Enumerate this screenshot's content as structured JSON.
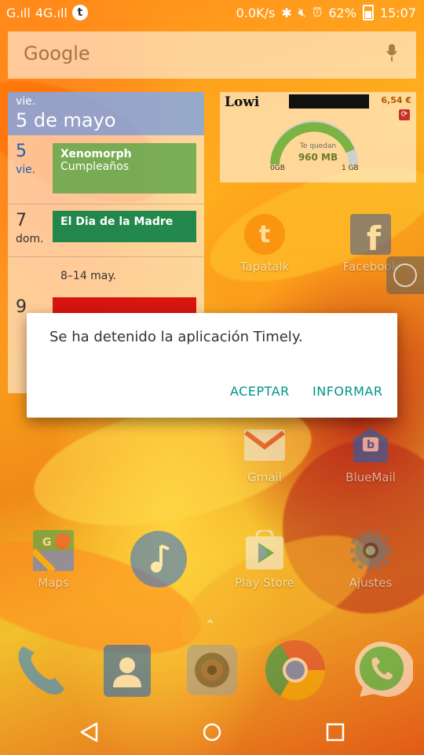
{
  "status_bar": {
    "signal_1": "G.ıll",
    "signal_2_type": "4G",
    "signal_2": "4G.ıll",
    "speed": "0.0K/s",
    "battery": "62%",
    "time": "15:07"
  },
  "search_bar": {
    "logo": "Google"
  },
  "calendar": {
    "header_dow": "vie.",
    "header_date": "5 de mayo",
    "rows": [
      {
        "day_num": "5",
        "day_name": "vie.",
        "event_title": "Xenomorph",
        "event_subtitle": "Cumpleaños",
        "color": "#6aa84f"
      },
      {
        "day_num": "7",
        "day_name": "dom.",
        "event_title": "El Dia de la Madre",
        "color": "#0b8043"
      }
    ],
    "week_range": "8–14 may.",
    "row3_day_num": "9",
    "row3_color": "#d50000"
  },
  "lowi": {
    "brand": "Lowi",
    "price": "6,54 €",
    "remaining_label": "Te quedan",
    "remaining_value": "960 MB",
    "min_label": "0GB",
    "max_label": "1 GB"
  },
  "apps": {
    "tapatalk": "Tapatalk",
    "facebook": "Facebook",
    "gmail": "Gmail",
    "bluemail": "BlueMail",
    "maps": "Maps",
    "play_store": "Play Store",
    "ajustes": "Ajustes"
  },
  "dialog": {
    "message": "Se ha detenido la aplicación Timely.",
    "accept": "ACEPTAR",
    "report": "INFORMAR"
  },
  "dock": [
    "phone-icon",
    "contacts-icon",
    "camera-icon",
    "chrome-icon",
    "whatsapp-icon"
  ],
  "nav": [
    "back-icon",
    "home-icon",
    "recents-icon"
  ],
  "colors": {
    "accent": "#009688",
    "calendar_blue": "#4285f4"
  }
}
